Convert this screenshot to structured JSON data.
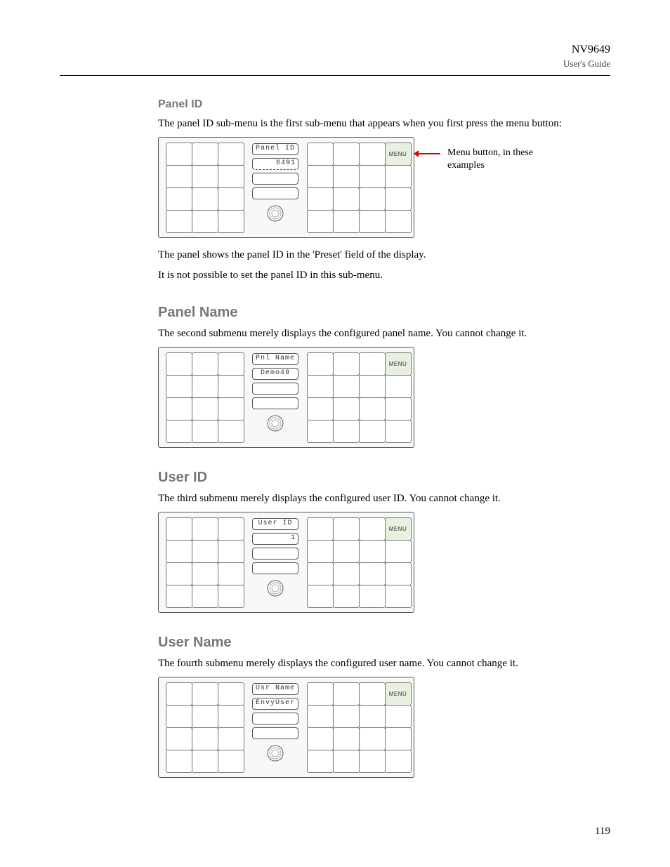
{
  "header": {
    "product": "NV9649",
    "subtitle": "User's Guide"
  },
  "section1": {
    "heading": "Panel ID",
    "intro": "The panel ID sub-menu is the first sub-menu that appears when you first press the menu button:",
    "para1": "The panel shows the panel ID in the 'Preset' field of the display.",
    "para2": "It is not possible to set the panel ID in this sub-menu."
  },
  "section2": {
    "heading": "Panel Name",
    "intro": "The second submenu merely displays the configured panel name. You cannot change it."
  },
  "section3": {
    "heading": "User ID",
    "intro": "The third submenu merely displays the configured user ID. You cannot change it."
  },
  "section4": {
    "heading": "User Name",
    "intro": "The fourth submenu merely displays the configured user name. You cannot change it."
  },
  "panel1": {
    "field1": "Panel ID",
    "field2": "6491",
    "menu": "MENU"
  },
  "panel2": {
    "field1": "Pnl Name",
    "field2": "Demo49",
    "menu": "MENU"
  },
  "panel3": {
    "field1": "User ID",
    "field2": "1",
    "menu": "MENU"
  },
  "panel4": {
    "field1": "Usr Name",
    "field2": "EnvyUser",
    "menu": "MENU"
  },
  "callout": "Menu button, in these examples",
  "pagenum": "119"
}
